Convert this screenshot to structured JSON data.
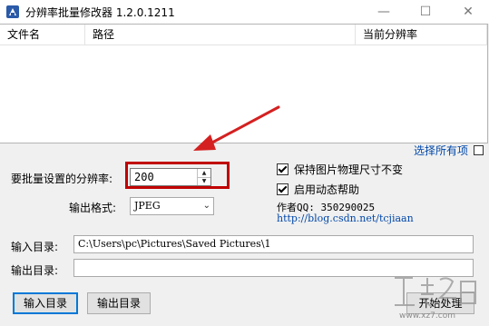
{
  "window": {
    "title": "分辨率批量修改器 1.2.0.1211",
    "minimize_glyph": "—",
    "maximize_glyph": "☐",
    "close_glyph": "✕"
  },
  "file_list": {
    "columns": [
      "文件名",
      "路径",
      "当前分辨率"
    ]
  },
  "select_all": {
    "label": "选择所有项",
    "checked": false
  },
  "resolution": {
    "label": "要批量设置的分辨率:",
    "value": "200"
  },
  "format": {
    "label": "输出格式:",
    "selected": "JPEG"
  },
  "options": {
    "keep_size_label": "保持图片物理尺寸不变",
    "keep_size_checked": true,
    "dynamic_help_label": "启用动态帮助",
    "dynamic_help_checked": true
  },
  "author": {
    "text": "作者QQ: 350290025",
    "link": "http://blog.csdn.net/tcjiaan"
  },
  "input_dir": {
    "label": "输入目录:",
    "value": "C:\\Users\\pc\\Pictures\\Saved Pictures\\1"
  },
  "output_dir": {
    "label": "输出目录:",
    "value": ""
  },
  "buttons": {
    "input_dir": "输入目录",
    "output_dir": "输出目录",
    "start": "开始处理"
  },
  "annotation": {
    "color": "#d42020"
  },
  "watermark": {
    "domain": "www.xz7.com"
  },
  "icons": {
    "app": "app-logo-icon",
    "spin_up": "spin-up-arrow-icon",
    "spin_down": "spin-down-arrow-icon",
    "dropdown": "chevron-down-icon"
  }
}
